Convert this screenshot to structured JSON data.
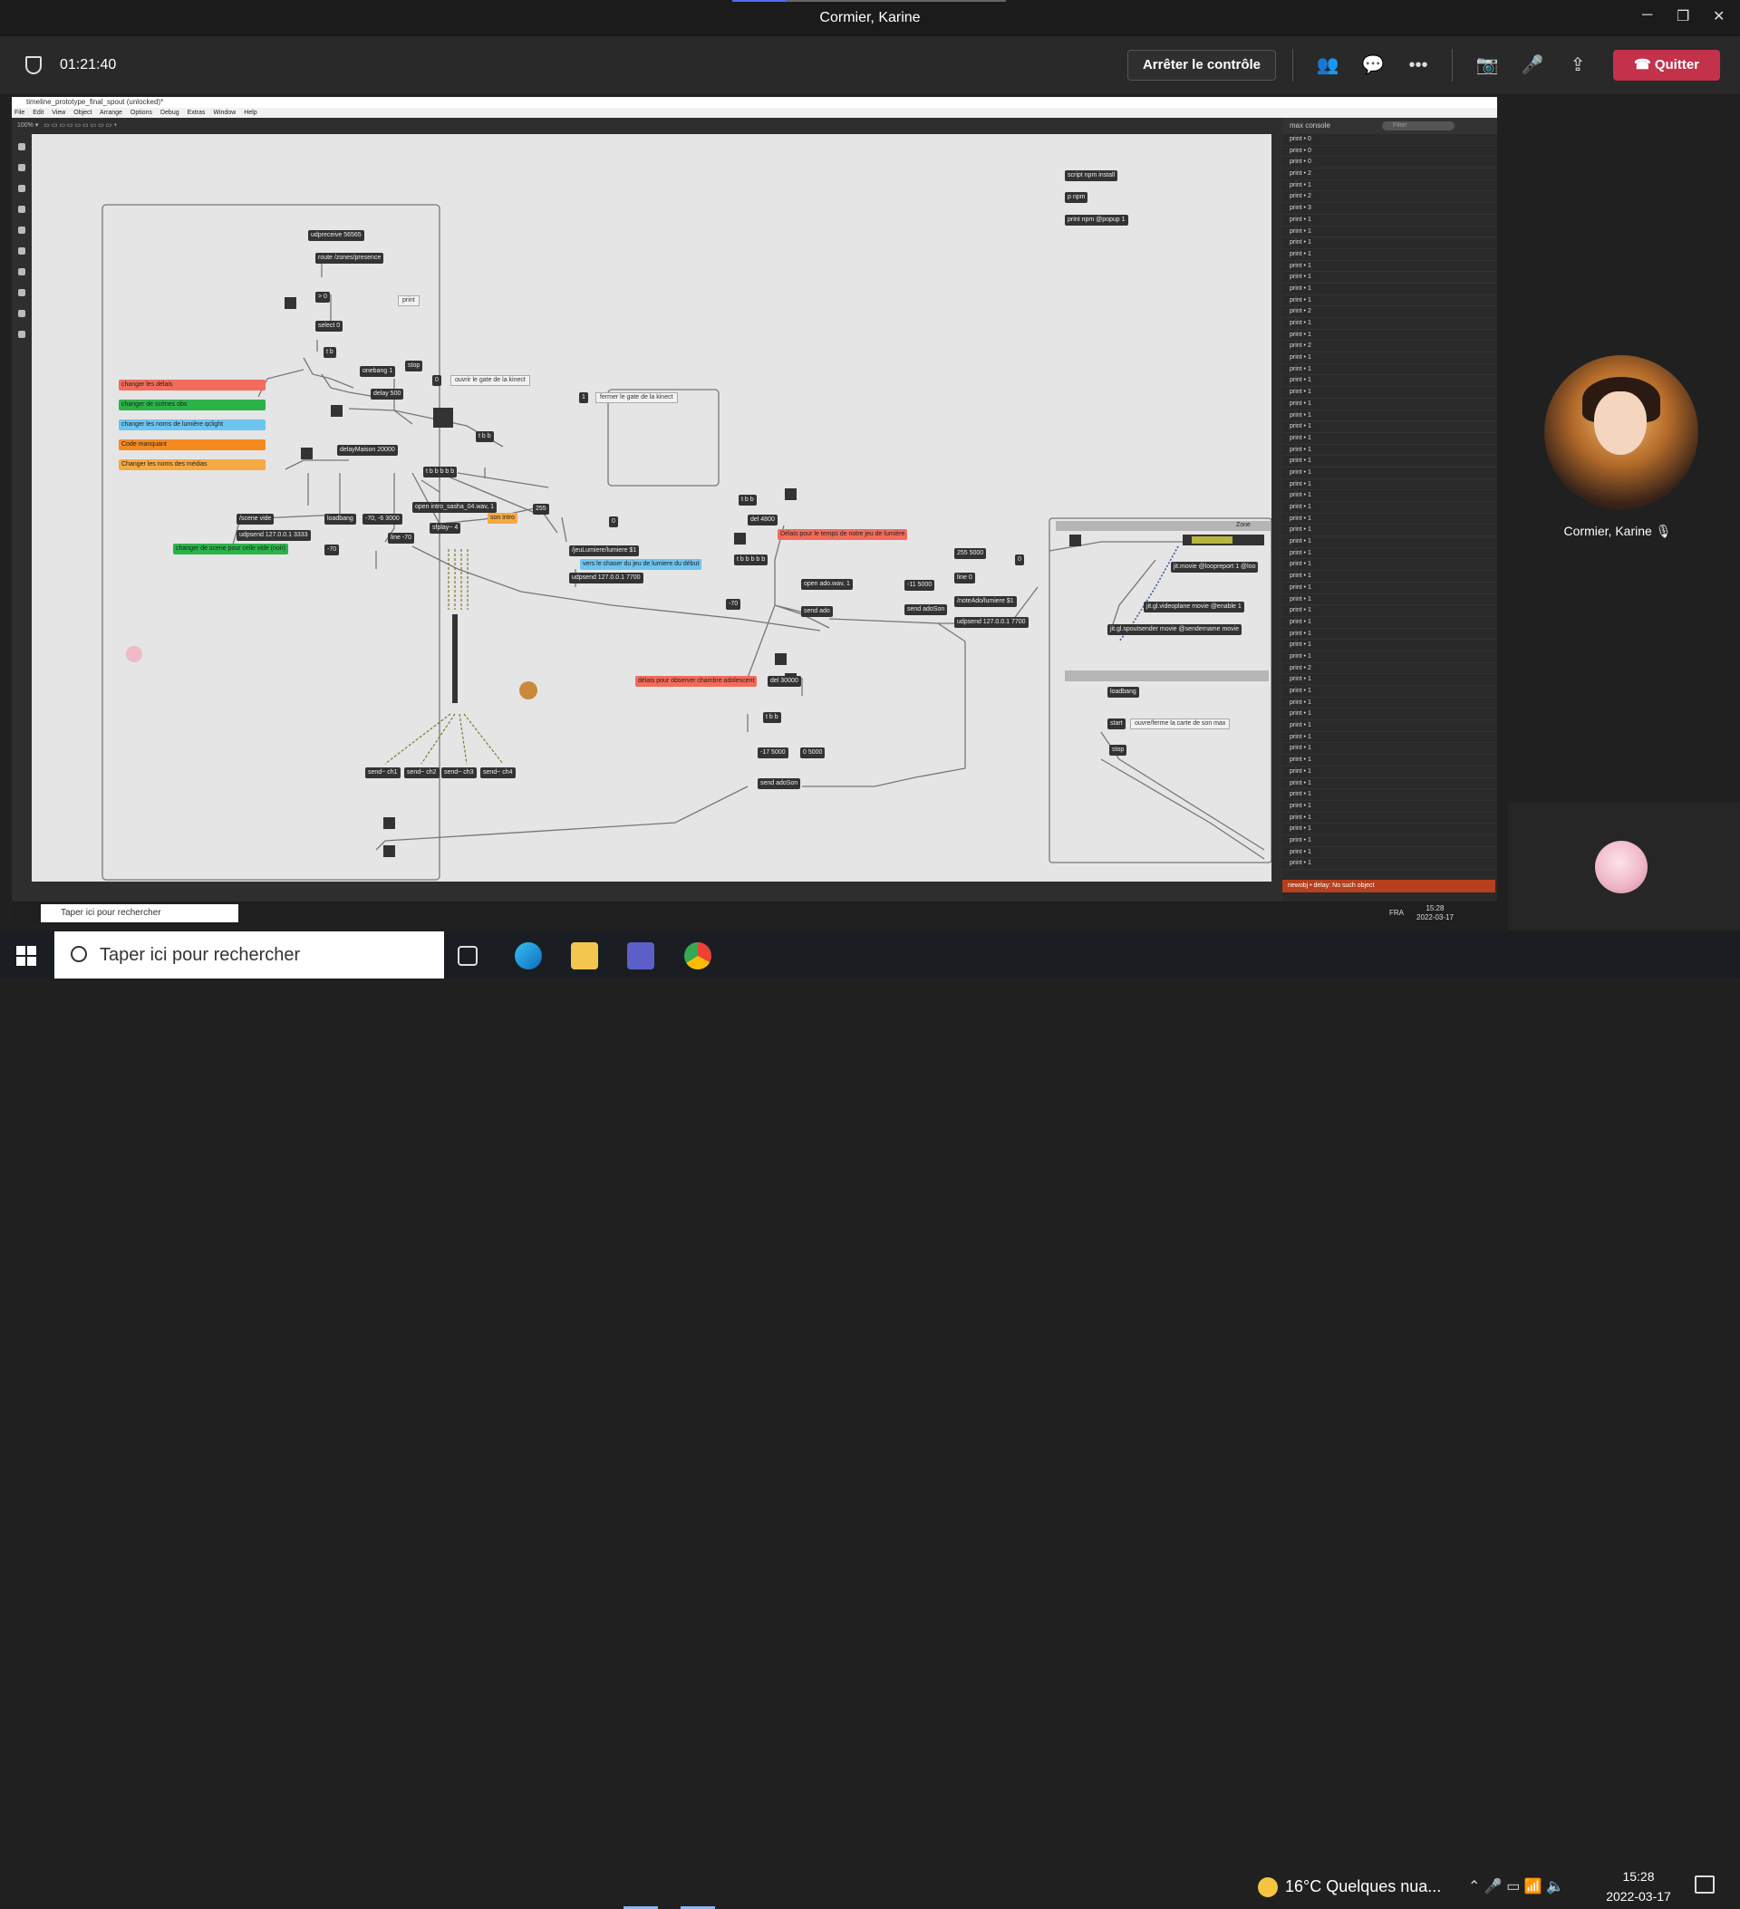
{
  "teams": {
    "title": "Cormier, Karine",
    "timer": "01:21:40",
    "stop_control": "Arrêter le contrôle",
    "quit": "Quitter"
  },
  "participant": {
    "name": "Cormier, Karine"
  },
  "max": {
    "window_title": "timeline_prototype_final_spout (unlocked)*",
    "menu": [
      "File",
      "Edit",
      "View",
      "Object",
      "Arrange",
      "Options",
      "Debug",
      "Extras",
      "Window",
      "Help"
    ],
    "zoom": "100%",
    "console_title": "max console",
    "filter_placeholder": "Filter",
    "error": "newobj • delay: No such object",
    "legend": [
      {
        "text": "changer les délais",
        "color": "#f26b5b"
      },
      {
        "text": "changer de scènes obs",
        "color": "#2bb34a"
      },
      {
        "text": "changer les noms de lumière qclight",
        "color": "#6cc4f0"
      },
      {
        "text": "Code manquant",
        "color": "#f58a1f"
      },
      {
        "text": "Changer les noms des médias",
        "color": "#f5a942"
      }
    ],
    "objects": {
      "o1": "udpreceive 56565",
      "o2": "route /zones/presence",
      "o3": "> 0",
      "o4": "print",
      "o5": "select 0",
      "o6": "t b",
      "o7": "onebang 1",
      "o8": "stop",
      "o9": "delay 500",
      "o10": "0",
      "o11": "ouvrir le gate de la kinect",
      "o12": "1",
      "o13": "fermer le gate de la kinect",
      "o14": "t b b",
      "o15": "delayMaison 20000",
      "o16": "t b b b b b",
      "o17": "/scene vide",
      "o18": "udpsend 127.0.0.1 3333",
      "o19": "changer de scene pour celle vide (noir)",
      "o20": "loadbang",
      "o21": "-70, -6 3000",
      "o22": "-70",
      "o23": "open intro_sasha_04.wav, 1",
      "o24": "son intro",
      "o25": "255",
      "o26": "sfplay~ 4",
      "o27": "line -70",
      "o28": "0",
      "o29": "/jeuLumiere/lumiere $1",
      "o30": "vers le chaser du jeu de lumiere du début",
      "o31": "udpsend 127.0.0.1 7700",
      "o32": "t b b",
      "o33": "del 4800",
      "o34": "Délais pour le temps de notre jeu de lumière",
      "o35": "t b b b b b",
      "o36": "-70",
      "o37": "open ado.wav, 1",
      "o38": "send ado",
      "o39": "-11 5000",
      "o40": "send adoSon",
      "o41": "255 5000",
      "o42": "line 0",
      "o43": "/noteAdo/lumiere $1",
      "o44": "udpsend 127.0.0.1 7700",
      "o45": "0",
      "o46": "délais pour observer chambre adolescent",
      "o47": "del 30000",
      "o48": "t b b",
      "o49": "-17 5000",
      "o50": "0 5000",
      "o51": "send adoSon",
      "o52": "send~ ch1",
      "o53": "send~ ch2",
      "o54": "send~ ch3",
      "o55": "send~ ch4",
      "o56": "script npm install",
      "o57": "p npm",
      "o58": "print npm @popup 1",
      "o59": "Zone",
      "o60": "jit.movie @loopreport 1 @loo",
      "o61": "jit.gl.videoplane movie @enable 1",
      "o62": "jit.gl.spoutsender movie @sendername movie",
      "o63": "loadbang",
      "o64": "start",
      "o65": "ouvre/ferme la carte de son max",
      "o66": "stop"
    }
  },
  "console_lines": [
    "print • 0",
    "print • 0",
    "print • 0",
    "print • 2",
    "print • 1",
    "print • 2",
    "print • 3",
    "print • 1",
    "print • 1",
    "print • 1",
    "print • 1",
    "print • 1",
    "print • 1",
    "print • 1",
    "print • 1",
    "print • 2",
    "print • 1",
    "print • 1",
    "print • 2",
    "print • 1",
    "print • 1",
    "print • 1",
    "print • 1",
    "print • 1",
    "print • 1",
    "print • 1",
    "print • 1",
    "print • 1",
    "print • 1",
    "print • 1",
    "print • 1",
    "print • 1",
    "print • 1",
    "print • 1",
    "print • 1",
    "print • 1",
    "print • 1",
    "print • 1",
    "print • 1",
    "print • 1",
    "print • 1",
    "print • 1",
    "print • 1",
    "print • 1",
    "print • 1",
    "print • 1",
    "print • 2",
    "print • 1",
    "print • 1",
    "print • 1",
    "print • 1",
    "print • 1",
    "print • 1",
    "print • 1",
    "print • 1",
    "print • 1",
    "print • 1",
    "print • 1",
    "print • 1",
    "print • 1",
    "print • 1",
    "print • 1",
    "print • 1",
    "print • 1"
  ],
  "inner_taskbar": {
    "search": "Taper ici pour rechercher",
    "lang": "FRA",
    "time": "15:28",
    "date": "2022-03-17"
  },
  "taskbar": {
    "search": "Taper ici pour rechercher",
    "weather": "16°C  Quelques nua...",
    "time": "15:28",
    "date": "2022-03-17"
  },
  "colors": {
    "accent": "#c4314b",
    "teams_bg": "#292929",
    "max_bg": "#e5e5e5"
  }
}
